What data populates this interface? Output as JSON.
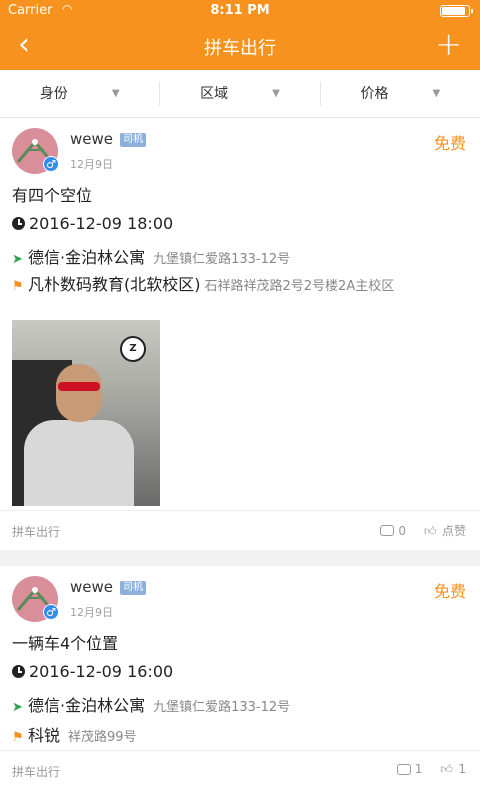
{
  "status_bar": {
    "carrier": "Carrier",
    "time": "8:11 PM",
    "battery_level": 0.9
  },
  "nav": {
    "title": "拼车出行",
    "back_icon": "chevron-left-icon",
    "add_icon": "plus-icon"
  },
  "filters": [
    {
      "label": "身份"
    },
    {
      "label": "区域"
    },
    {
      "label": "价格"
    }
  ],
  "posts": [
    {
      "username": "wewe",
      "role": "司机",
      "date": "12月9日",
      "price": "免费",
      "description": "有四个空位",
      "datetime": "2016-12-09 18:00",
      "from_place": "德信·金泊林公寓",
      "from_address": "九堡镇仁爱路133-12号",
      "to_place": "凡朴数码教育(北软校区)",
      "to_address": "石祥路祥茂路2号2号楼2A主校区",
      "category": "拼车出行",
      "comments": "0",
      "likes": "点赞"
    },
    {
      "username": "wewe",
      "role": "司机",
      "date": "12月9日",
      "price": "免费",
      "description": "一辆车4个位置",
      "datetime": "2016-12-09 16:00",
      "from_place": "德信·金泊林公寓",
      "from_address": "九堡镇仁爱路133-12号",
      "to_place": "科锐",
      "to_address": "祥茂路99号",
      "category": "拼车出行",
      "comments": "1",
      "likes": "1"
    }
  ],
  "colors": {
    "accent": "#f7921e",
    "route_start": "#2ea44f",
    "role_badge": "#8fb0dd"
  }
}
